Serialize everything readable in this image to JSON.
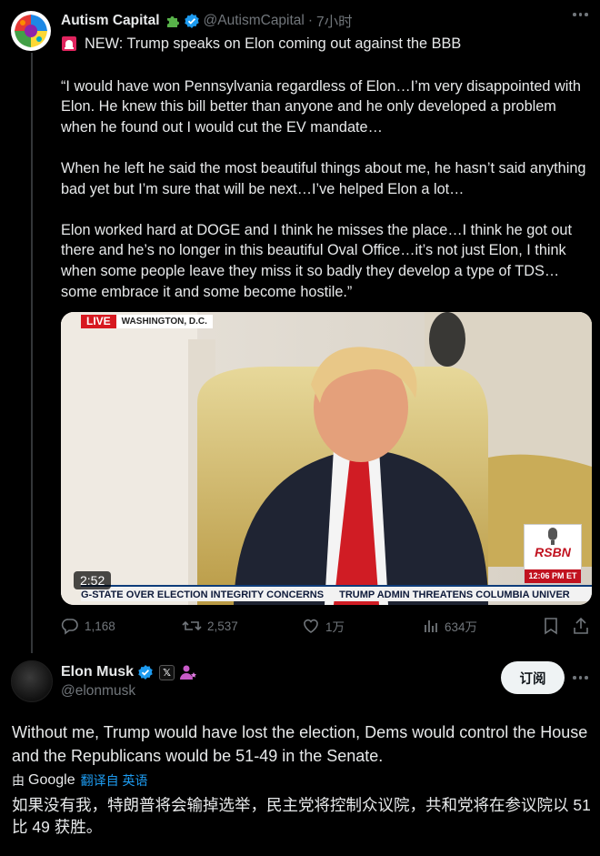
{
  "tweet1": {
    "display_name": "Autism Capital",
    "handle": "@AutismCapital",
    "separator": "·",
    "time": "7小时",
    "headline": "NEW: Trump speaks on Elon coming out against the BBB",
    "paragraphs": [
      "“I would have won Pennsylvania regardless of Elon…I’m very disappointed with Elon. He knew this bill better than anyone and he only developed a problem when he found out I would cut the EV mandate…",
      "When he left he said the most beautiful things about me, he hasn’t said anything bad yet but I’m sure that will be next…I’ve helped Elon a lot…",
      "Elon worked hard at DOGE and I think he misses the place…I think he got out there and he’s no longer in this beautiful Oval Office…it’s not just Elon, I think when some people leave they miss it so badly they develop a type of TDS…some embrace it and some become hostile.”"
    ],
    "video": {
      "live_label": "LIVE",
      "location": "WASHINGTON, D.C.",
      "duration": "2:52",
      "ticker": [
        "G-STATE OVER ELECTION INTEGRITY CONCERNS",
        "TRUMP ADMIN THREATENS COLUMBIA UNIVER"
      ],
      "badge_text": "RSBN",
      "badge_time": "12:06 PM ET"
    },
    "stats": {
      "replies": "1,168",
      "reposts": "2,537",
      "likes": "1万",
      "views": "634万"
    }
  },
  "tweet2": {
    "display_name": "Elon Musk",
    "handle": "@elonmusk",
    "x_badge": "𝕏",
    "subscribe_label": "订阅",
    "text": "Without me, Trump would have lost the election, Dems would control the House and the Republicans would be 51-49 in the Senate.",
    "translate_prefix": "由",
    "translate_provider": "Google",
    "translate_link": "翻译自 英语",
    "translated_text": "如果没有我，特朗普将会输掉选举，民主党将控制众议院，共和党将在参议院以 51 比 49 获胜。"
  },
  "colors": {
    "background": "#000000",
    "text": "#e7e9ea",
    "muted": "#71767b",
    "link": "#1d9bf0",
    "verified": "#1d9bf0"
  }
}
